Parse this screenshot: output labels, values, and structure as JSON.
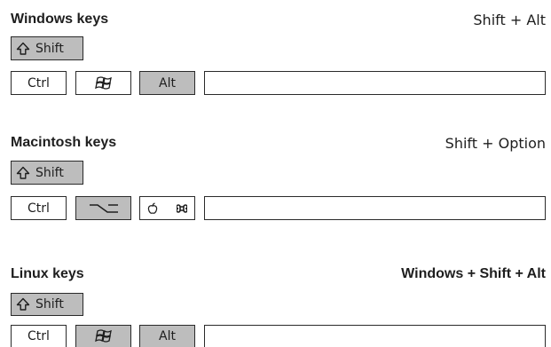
{
  "windows": {
    "title": "Windows keys",
    "combo": "Shift + Alt",
    "keys": {
      "shift": "Shift",
      "ctrl": "Ctrl",
      "alt": "Alt"
    }
  },
  "mac": {
    "title": "Macintosh keys",
    "combo": "Shift + Option",
    "keys": {
      "shift": "Shift",
      "ctrl": "Ctrl"
    }
  },
  "linux": {
    "title": "Linux keys",
    "combo": "Windows + Shift + Alt",
    "keys": {
      "shift": "Shift",
      "ctrl": "Ctrl",
      "alt": "Alt"
    }
  },
  "icons": {
    "shift": "shift-arrow-icon",
    "windows": "windows-logo-icon",
    "option": "option-icon",
    "apple": "apple-icon",
    "command": "command-icon"
  },
  "colors": {
    "pressed": "#bdbdbd",
    "border": "#2a2a2a"
  }
}
